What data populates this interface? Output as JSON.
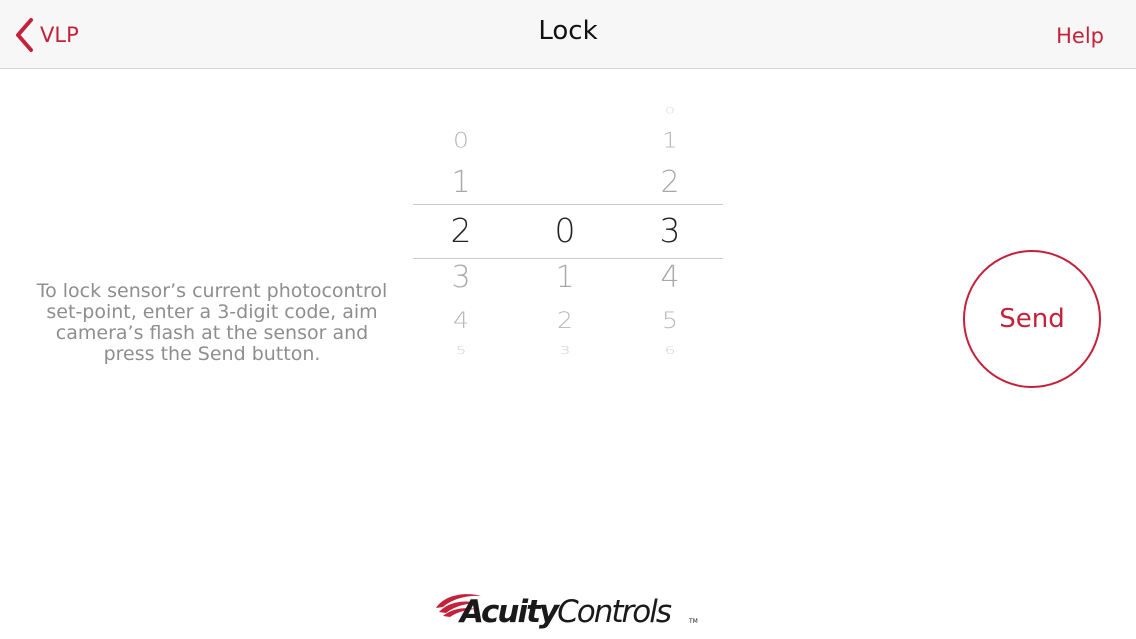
{
  "navbar": {
    "back_label": "VLP",
    "title": "Lock",
    "help_label": "Help"
  },
  "instructions": "To lock sensor’s current photocontrol set-point, enter a 3-digit code, aim camera’s flash at the sensor and press the Send button.",
  "picker": {
    "selected_code": [
      "2",
      "0",
      "3"
    ],
    "wheels": [
      {
        "visible": [
          "0",
          "1",
          "2",
          "3",
          "4",
          "5"
        ],
        "selected": "2"
      },
      {
        "visible": [
          "0",
          "1",
          "2",
          "3"
        ],
        "selected": "0"
      },
      {
        "visible": [
          "0",
          "1",
          "2",
          "3",
          "4",
          "5",
          "6"
        ],
        "selected": "3"
      }
    ]
  },
  "send_label": "Send",
  "logo": {
    "acuity": "Acuity",
    "controls": "Controls",
    "trademark": "TM"
  },
  "colors": {
    "accent": "#c4213a",
    "selected_digit": "#222222",
    "unselected_digit": "#9a9a9a",
    "instruction_text": "#8e8e8e"
  },
  "icons": {
    "back": "chevron-left-icon",
    "logo_mark": "swoosh-logo-icon"
  }
}
